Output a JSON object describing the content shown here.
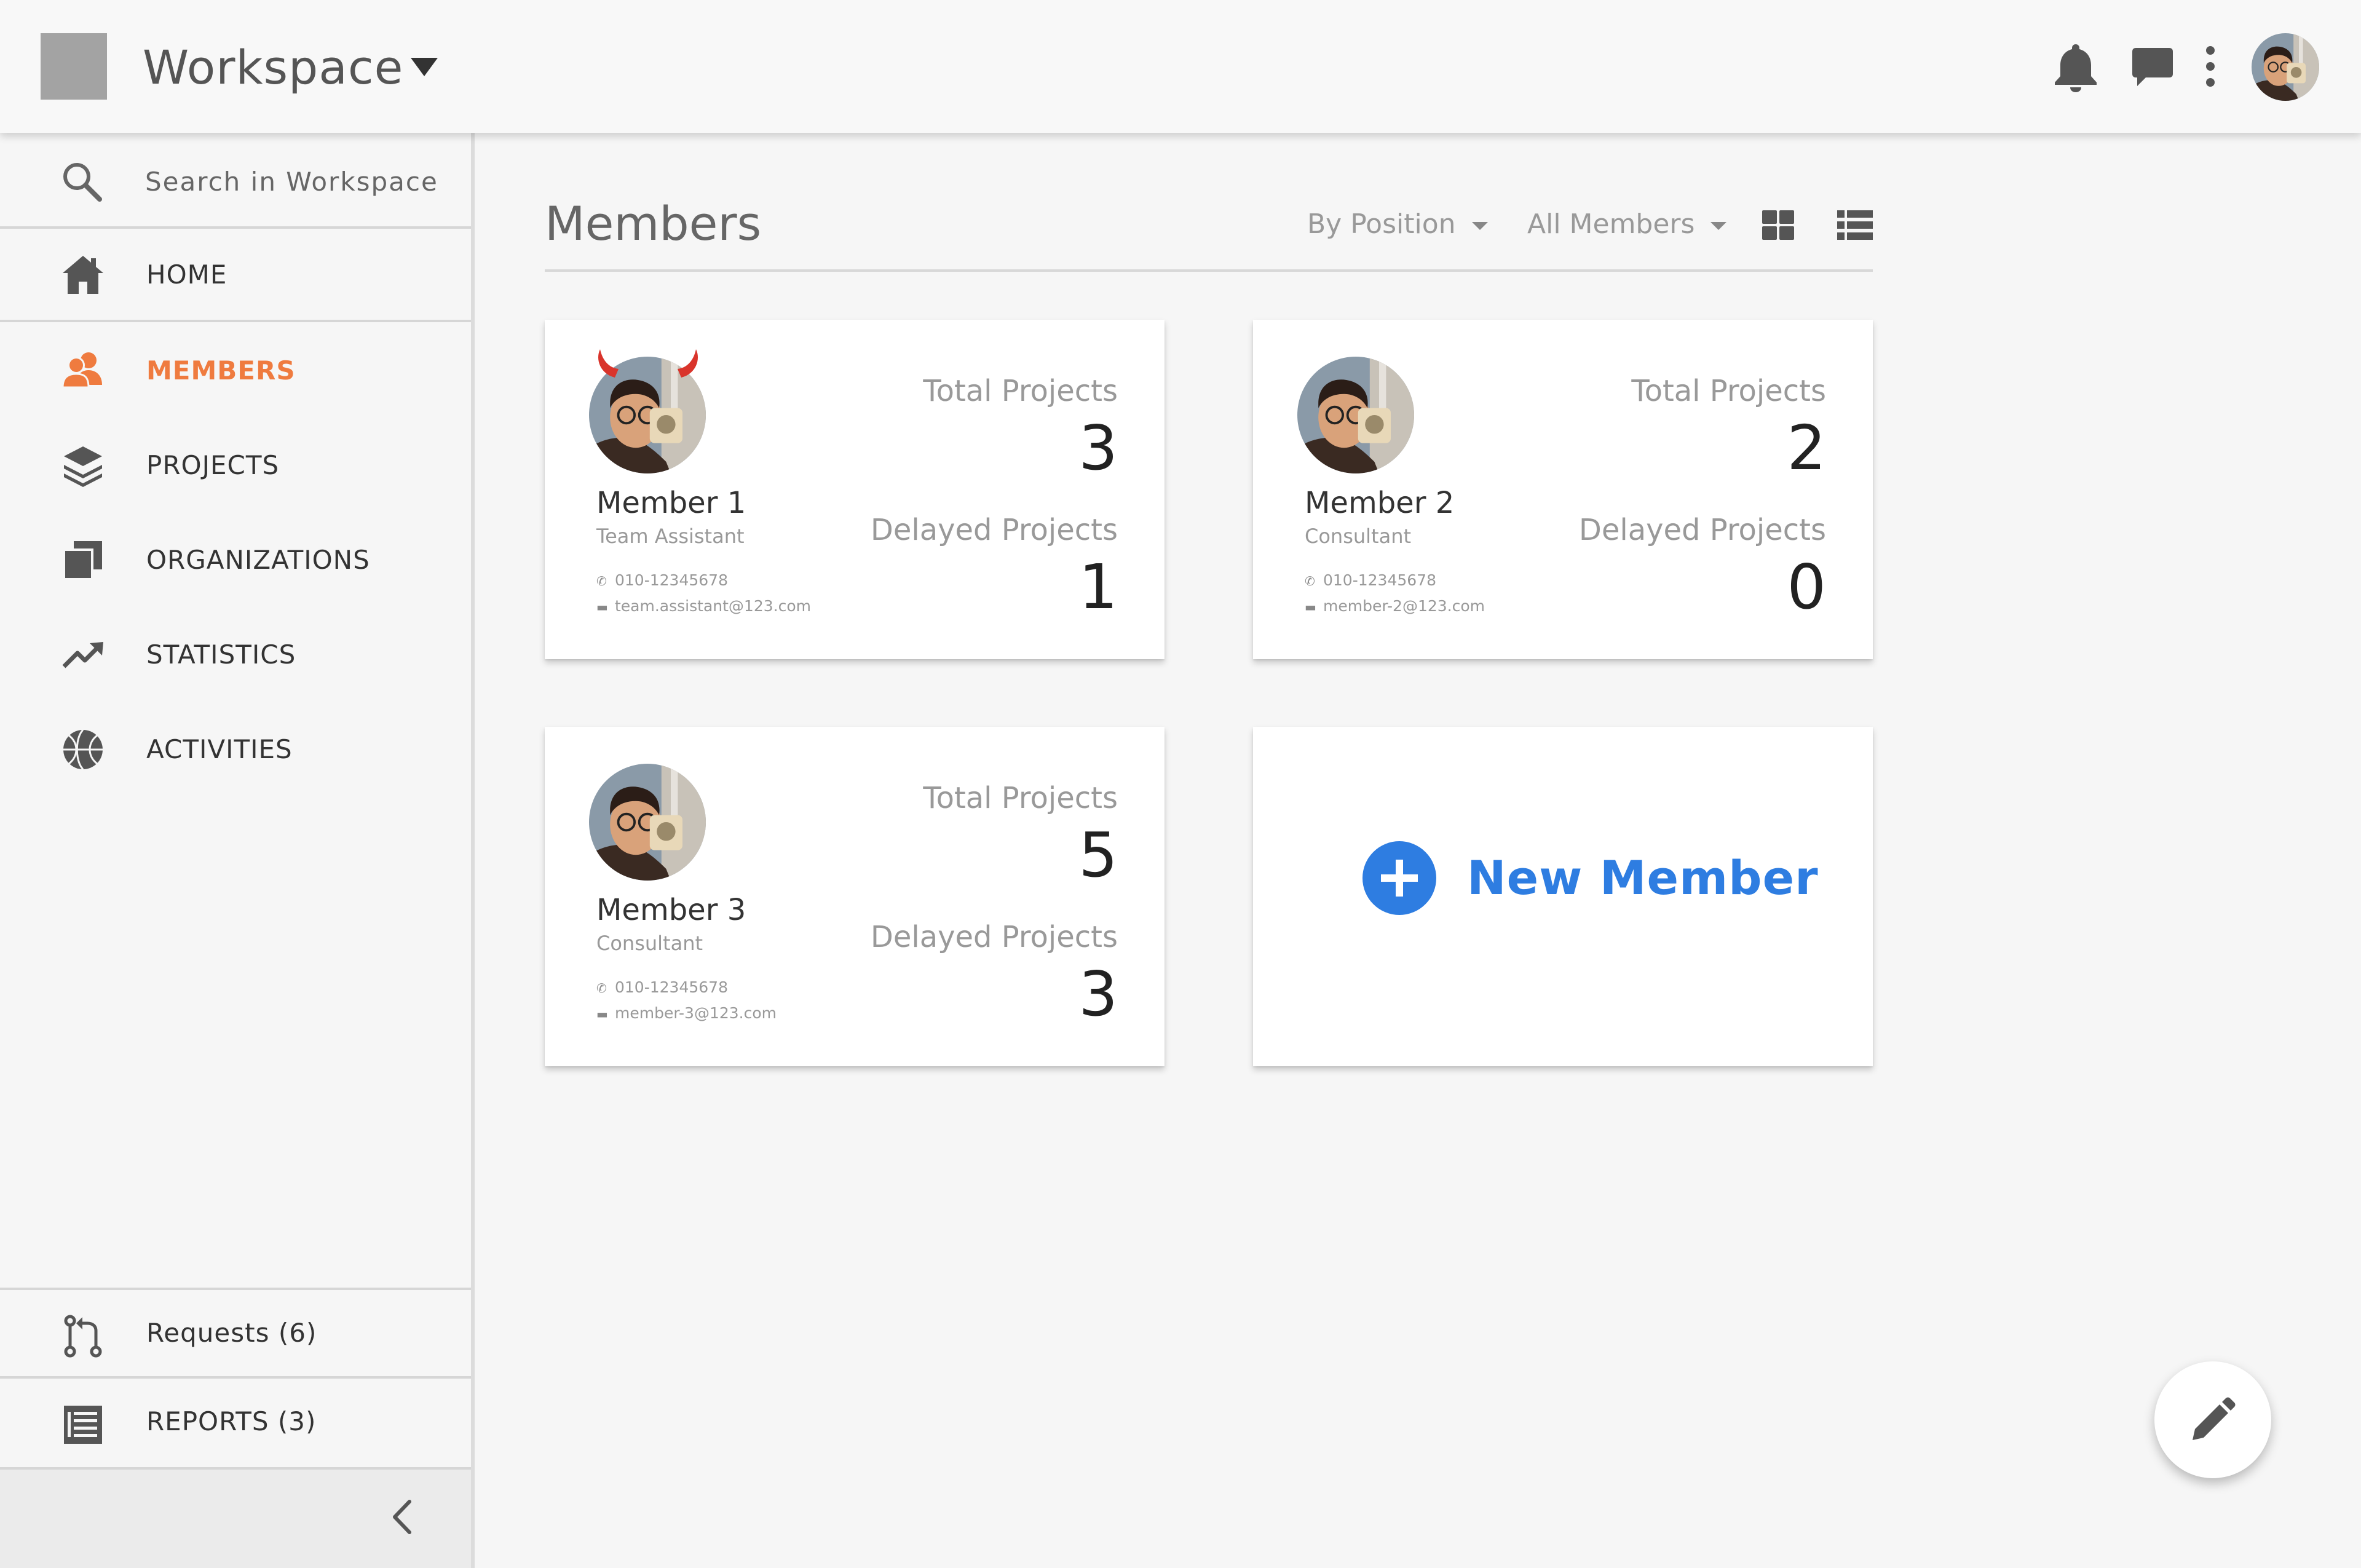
{
  "header": {
    "workspace_title": "Workspace",
    "icons": [
      "bell-icon",
      "chat-icon",
      "more-vert-icon",
      "user-avatar"
    ]
  },
  "sidebar": {
    "search_placeholder": "Search in Workspace",
    "items": [
      {
        "label": "HOME",
        "icon": "home-icon"
      },
      {
        "label": "MEMBERS",
        "icon": "members-icon",
        "active": true
      },
      {
        "label": "PROJECTS",
        "icon": "layers-icon"
      },
      {
        "label": "ORGANIZATIONS",
        "icon": "organizations-icon"
      },
      {
        "label": "STATISTICS",
        "icon": "trending-up-icon"
      },
      {
        "label": "ACTIVITIES",
        "icon": "basketball-icon"
      }
    ],
    "bottom_items": [
      {
        "label": "Requests (6)",
        "icon": "pull-request-icon"
      },
      {
        "label": "REPORTS (3)",
        "icon": "list-icon"
      }
    ]
  },
  "main": {
    "title": "Members",
    "filters": {
      "position": "By Position",
      "members": "All Members"
    },
    "members": [
      {
        "name": "Member 1",
        "position": "Team Assistant",
        "phone": "010-12345678",
        "email": "team.assistant@123.com",
        "total_label": "Total Projects",
        "total": "3",
        "delayed_label": "Delayed Projects",
        "delayed": "1"
      },
      {
        "name": "Member 2",
        "position": "Consultant",
        "phone": "010-12345678",
        "email": "member-2@123.com",
        "total_label": "Total Projects",
        "total": "2",
        "delayed_label": "Delayed Projects",
        "delayed": "0"
      },
      {
        "name": "Member 3",
        "position": "Consultant",
        "phone": "010-12345678",
        "email": "member-3@123.com",
        "total_label": "Total Projects",
        "total": "5",
        "delayed_label": "Delayed Projects",
        "delayed": "3"
      }
    ],
    "new_member_label": "New Member"
  },
  "colors": {
    "accent": "#ef7b3f",
    "primary": "#2e7de1"
  }
}
